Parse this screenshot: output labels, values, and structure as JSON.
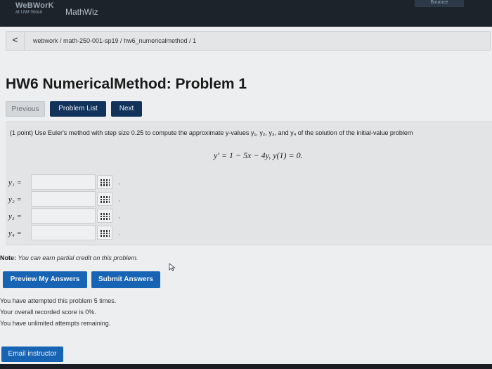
{
  "header": {
    "logo_line1": "WeBWorK",
    "logo_line2": "at UW-Stout",
    "app_name": "MathWiz",
    "top_tab": "Binance"
  },
  "breadcrumb": {
    "back_glyph": "<",
    "path": "webwork / math-250-001-sp19 / hw6_numericalmethod / 1"
  },
  "page_title": "HW6 NumericalMethod: Problem 1",
  "nav": {
    "previous": "Previous",
    "problem_list": "Problem List",
    "next": "Next"
  },
  "problem": {
    "statement": "(1 point) Use Euler's method with step size 0.25 to compute the approximate y-values y₁, y₂, y₃, and y₄ of the solution of the initial-value problem",
    "equation": "y′ = 1 − 5x − 4y,   y(1) = 0.",
    "answers": [
      {
        "label": "y₁ =",
        "value": "",
        "suffix": ","
      },
      {
        "label": "y₂ =",
        "value": "",
        "suffix": ","
      },
      {
        "label": "y₃ =",
        "value": "",
        "suffix": ","
      },
      {
        "label": "y₄ =",
        "value": "",
        "suffix": "."
      }
    ]
  },
  "note": {
    "label": "Note:",
    "text": " You can earn partial credit on this problem."
  },
  "actions": {
    "preview": "Preview My Answers",
    "submit": "Submit Answers"
  },
  "status": {
    "attempts": "You have attempted this problem 5 times.",
    "score": "Your overall recorded score is 0%.",
    "remaining": "You have unlimited attempts remaining."
  },
  "email_instructor": "Email instructor",
  "colors": {
    "primary_button": "#1764b4",
    "dark_nav_button": "#10325b",
    "header_bg": "#1d232b"
  }
}
